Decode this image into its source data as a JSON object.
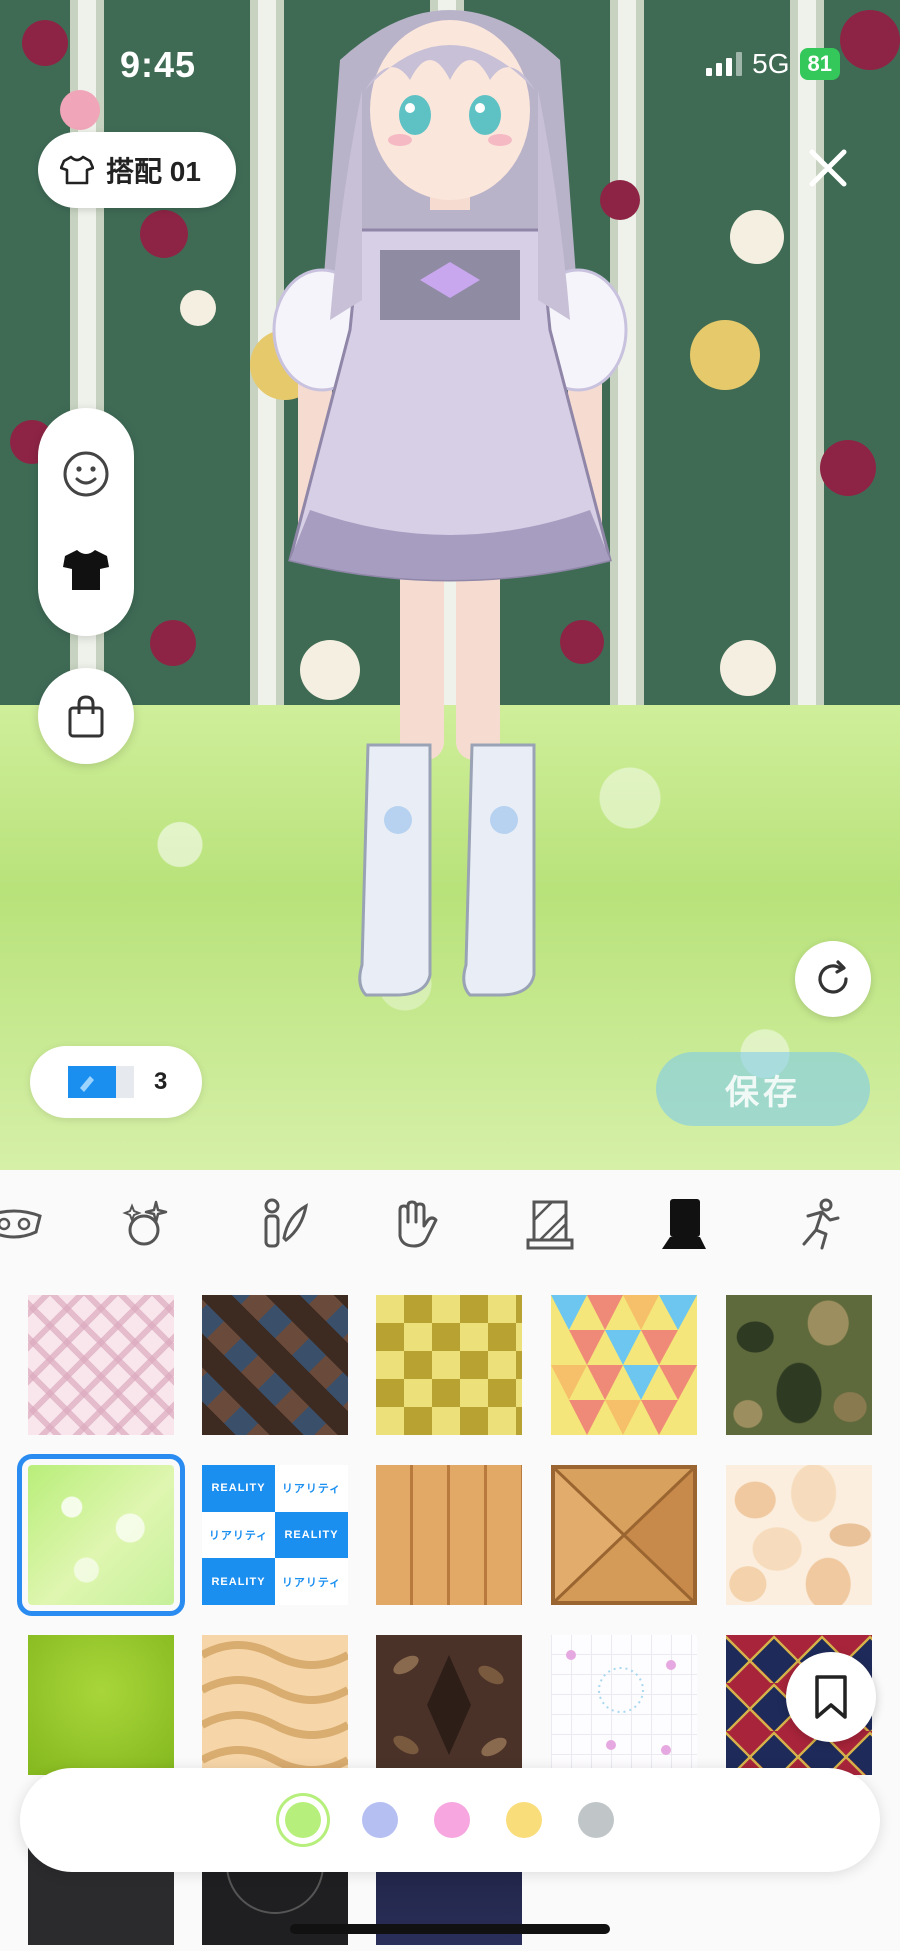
{
  "status": {
    "time": "9:45",
    "network": "5G",
    "battery": "81"
  },
  "outfit": {
    "label": "搭配 01"
  },
  "ticket": {
    "count": "3"
  },
  "save_label": "保存",
  "categories": [
    {
      "name": "accessory-icon",
      "active": false
    },
    {
      "name": "effect-icon",
      "active": false
    },
    {
      "name": "pose-icon",
      "active": false
    },
    {
      "name": "hand-icon",
      "active": false
    },
    {
      "name": "wall-icon",
      "active": false
    },
    {
      "name": "floor-icon",
      "active": true
    },
    {
      "name": "motion-icon",
      "active": false
    }
  ],
  "tiles": [
    {
      "name": "plaid-pink"
    },
    {
      "name": "argyle-brown"
    },
    {
      "name": "checker-yellow"
    },
    {
      "name": "triangle-color"
    },
    {
      "name": "camo-green"
    },
    {
      "name": "bokeh-green",
      "selected": true
    },
    {
      "name": "reality-logo"
    },
    {
      "name": "wood-planks"
    },
    {
      "name": "wood-parquet"
    },
    {
      "name": "stone-beige"
    },
    {
      "name": "grass-green"
    },
    {
      "name": "sand-dunes"
    },
    {
      "name": "leaf-dark"
    },
    {
      "name": "paw-print-grid"
    },
    {
      "name": "harlequin-navy"
    },
    {
      "name": "rose-dark"
    },
    {
      "name": "magic-circle"
    },
    {
      "name": "night-sky"
    }
  ],
  "reality_tile_text": {
    "en": "REALITY",
    "jp": "リアリティ"
  },
  "colors": [
    "#b6ef7b",
    "#b5bff2",
    "#f7a6df",
    "#f9dd7a",
    "#c0c6c8"
  ]
}
